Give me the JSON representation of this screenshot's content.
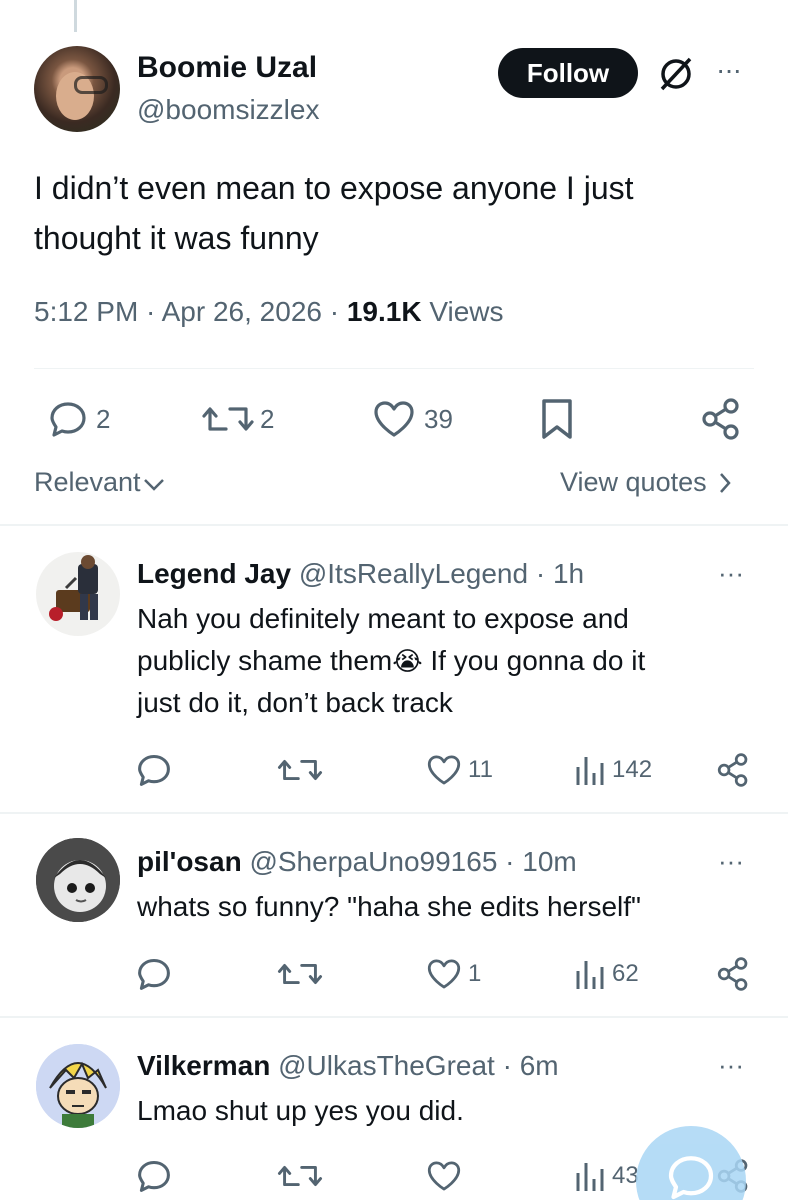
{
  "tweet": {
    "name": "Boomie Uzal",
    "handle": "@boomsizzlex",
    "follow_label": "Follow",
    "more_label": "···",
    "text_line1": "I didn’t even mean to expose anyone I just",
    "text_line2": "thought it was funny",
    "time": "5:12 PM · Apr 26, 2026 · ",
    "views_count": "19.1K",
    "views_label": " Views",
    "replies": "2",
    "reposts": "2",
    "likes": "39"
  },
  "sort": {
    "label": "Relevant",
    "view_quotes": "View quotes"
  },
  "replies": [
    {
      "name": "Legend Jay",
      "handle": "@ItsReallyLegend · 1h",
      "line1": "Nah you definitely meant to expose and",
      "line2a": "publicly shame them",
      "emoji": "😭",
      "line2b": " If you gonna do it",
      "line3": "just do it, don’t back track",
      "likes": "11",
      "views": "142"
    },
    {
      "name": "pil'osan",
      "handle": "@SherpaUno99165 · 10m",
      "line1": "whats so funny? \"haha she edits herself\"",
      "likes": "1",
      "views": "62"
    },
    {
      "name": "Vilkerman",
      "handle": "@UlkasTheGreat · 6m",
      "line1": "Lmao shut up yes you did.",
      "views": "43"
    }
  ],
  "more_icon": "···",
  "colors": {
    "text": "#0f1419",
    "secondary": "#536471",
    "divider": "#eff3f4",
    "fab": "#a9d6f5"
  }
}
